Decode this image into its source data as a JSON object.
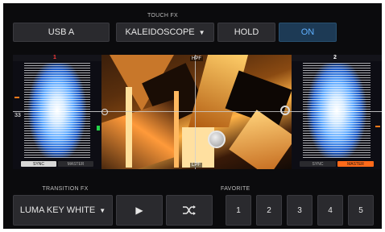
{
  "header": {
    "touch_fx_label": "TOUCH FX",
    "source_button": "USB A",
    "effect_select": "KALEIDOSCOPE",
    "hold_button": "HOLD",
    "on_button": "ON"
  },
  "decks": {
    "left": {
      "number": "1",
      "tempo_tick": "33",
      "sync": "SYNC",
      "master": "MASTER"
    },
    "right": {
      "number": "2",
      "sync": "SYNC",
      "master": "MASTER"
    }
  },
  "xy_pad": {
    "top_label": "HPF",
    "bottom_label": "LPF"
  },
  "footer": {
    "transition_fx_label": "TRANSITION FX",
    "transition_select": "LUMA KEY WHITE",
    "favorite_label": "FAVORITE",
    "favorites": [
      "1",
      "2",
      "3",
      "4",
      "5"
    ]
  },
  "colors": {
    "on_accent": "#5fb0ff",
    "master_active": "#ff6a1a",
    "waveform": "#5ea9ff"
  },
  "icons": {
    "dropdown": "chevron-down-icon",
    "play": "play-icon",
    "shuffle": "shuffle-icon"
  }
}
